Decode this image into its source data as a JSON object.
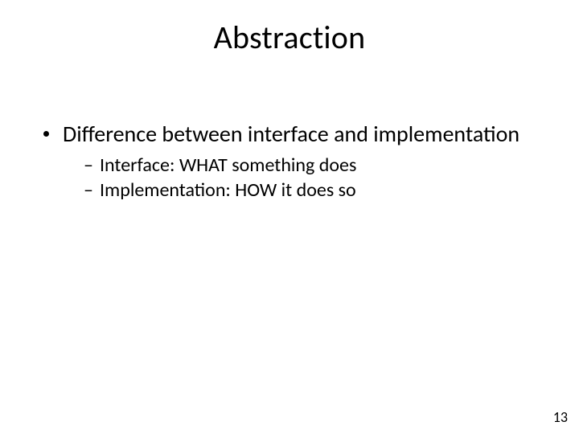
{
  "title": "Abstraction",
  "bullets": {
    "lvl1_text": "Difference between interface and implementation",
    "lvl2": [
      "Interface: WHAT something does",
      "Implementation: HOW it does so"
    ]
  },
  "dash": "–",
  "page_number": "13"
}
